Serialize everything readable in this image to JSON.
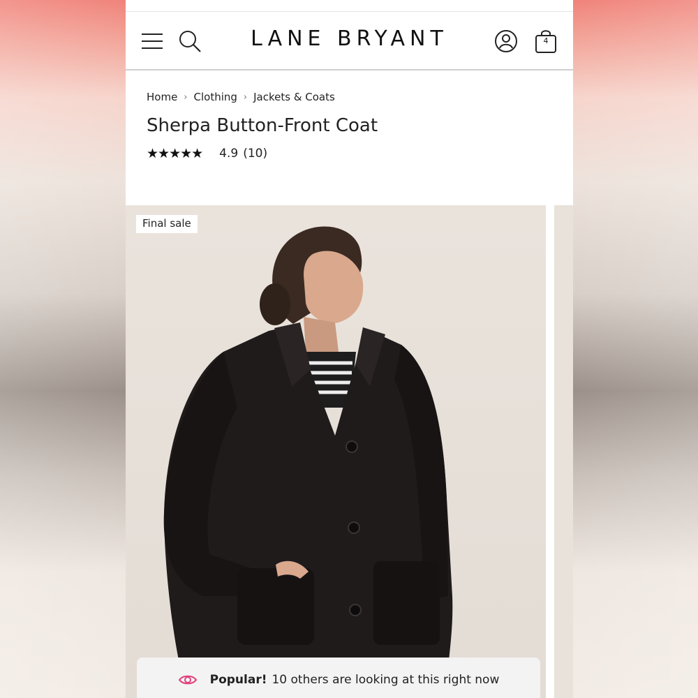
{
  "header": {
    "logo": "LANE BRYANT",
    "bag_count": "4",
    "icons": [
      "menu-icon",
      "search-icon",
      "account-icon",
      "bag-icon"
    ]
  },
  "breadcrumb": [
    "Home",
    "Clothing",
    "Jackets & Coats"
  ],
  "product": {
    "title": "Sherpa Button-Front Coat",
    "stars": "★★★★★",
    "rating": "4.9",
    "review_count": "(10)"
  },
  "gallery": {
    "badge": "Final sale",
    "popular_label": "Popular!",
    "popular_text": "10 others are looking at this right now"
  },
  "colors": {
    "accent": "#e0437d",
    "text": "#222222"
  }
}
